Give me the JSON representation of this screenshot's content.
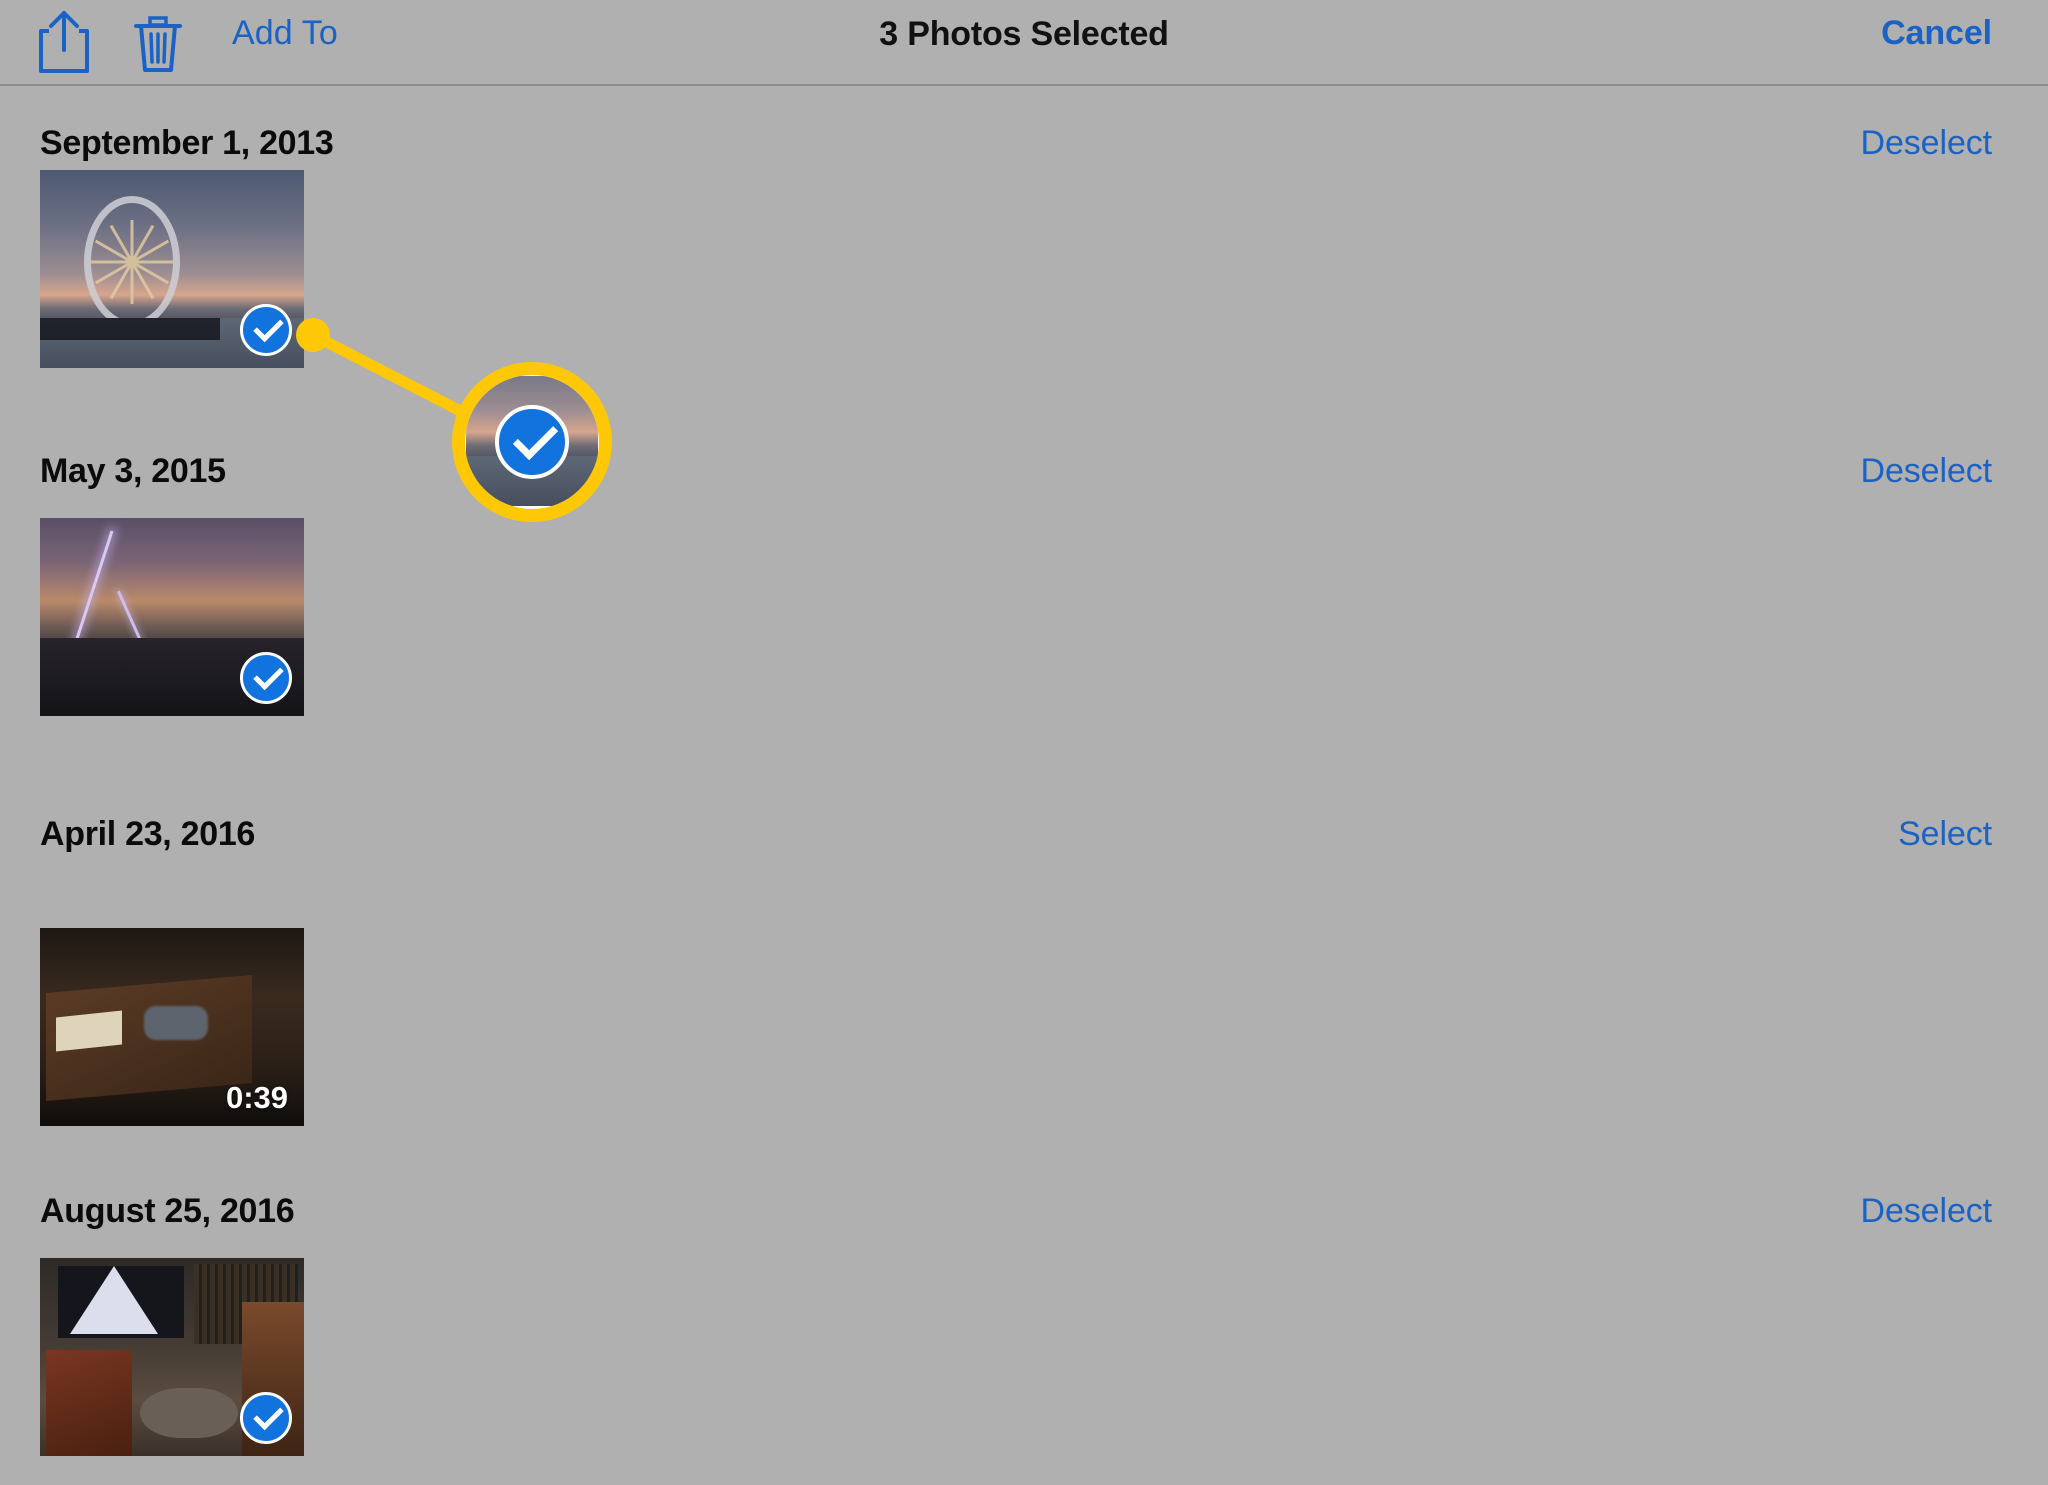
{
  "toolbar": {
    "share_icon": "share-icon",
    "trash_icon": "trash-icon",
    "add_to_label": "Add To",
    "title": "3 Photos Selected",
    "cancel_label": "Cancel"
  },
  "colors": {
    "background": "#b0b0b0",
    "link": "#1a62c4",
    "check_blue": "#1273de",
    "callout_yellow": "#FFC807",
    "divider": "#8c8c8c"
  },
  "sections": [
    {
      "date": "September 1, 2013",
      "action": "Deselect",
      "photos": [
        {
          "kind": "photo",
          "selected": true,
          "alt": "ferris-wheel-at-sunset",
          "duration": ""
        }
      ]
    },
    {
      "date": "May 3, 2015",
      "action": "Deselect",
      "photos": [
        {
          "kind": "photo",
          "selected": true,
          "alt": "lightning-storm",
          "duration": ""
        }
      ]
    },
    {
      "date": "April 23, 2016",
      "action": "Select",
      "photos": [
        {
          "kind": "video",
          "selected": false,
          "alt": "workbench-desk",
          "duration": "0:39"
        }
      ]
    },
    {
      "date": "August 25, 2016",
      "action": "Deselect",
      "photos": [
        {
          "kind": "photo",
          "selected": true,
          "alt": "living-room-with-dog",
          "duration": ""
        }
      ]
    }
  ],
  "callout": {
    "label": "magnified-selection-checkmark",
    "target": "selection-checkmark-on-first-photo"
  }
}
